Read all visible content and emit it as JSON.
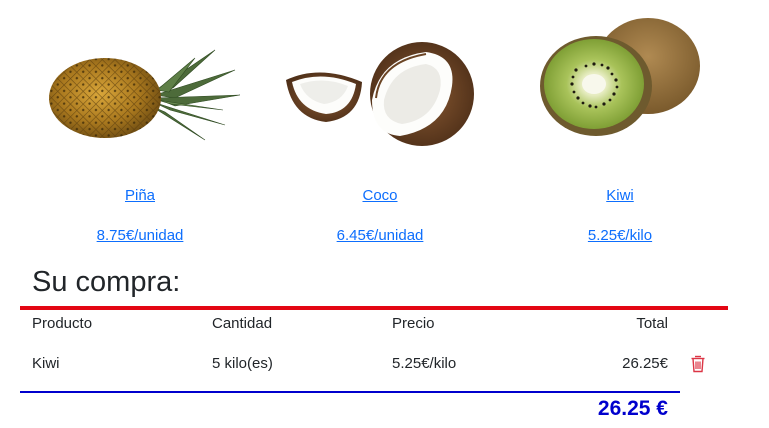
{
  "products": [
    {
      "name": "Piña",
      "price": "8.75€/unidad",
      "image": "pineapple"
    },
    {
      "name": "Coco",
      "price": "6.45€/unidad",
      "image": "coconut"
    },
    {
      "name": "Kiwi",
      "price": "5.25€/kilo",
      "image": "kiwi"
    }
  ],
  "cart": {
    "title": "Su compra:",
    "headers": {
      "product": "Producto",
      "quantity": "Cantidad",
      "price": "Precio",
      "total": "Total"
    },
    "items": [
      {
        "product": "Kiwi",
        "quantity": "5 kilo(es)",
        "price": "5.25€/kilo",
        "total": "26.25€",
        "delete_icon": "trash-icon"
      }
    ],
    "grand_total": "26.25 €"
  },
  "colors": {
    "link": "#0d6efd",
    "accent_red": "#e30613",
    "total_blue": "#0000cd"
  }
}
